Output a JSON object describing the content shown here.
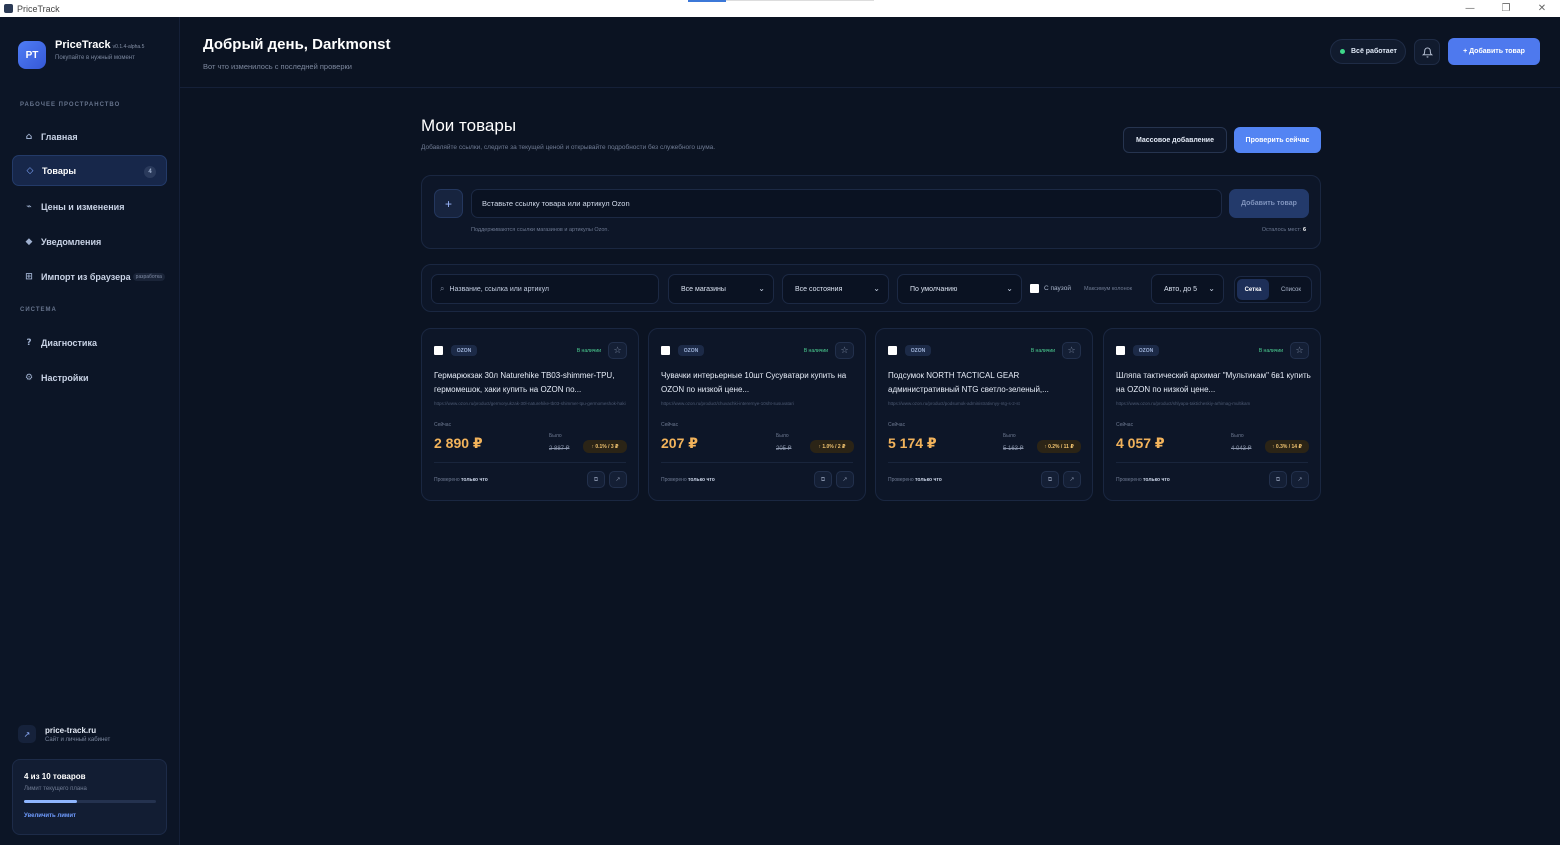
{
  "window": {
    "title": "PriceTrack",
    "controls": {
      "minimize": "—",
      "maximize": "❐",
      "close": "✕"
    }
  },
  "brand": {
    "logo": "PT",
    "name": "PriceTrack",
    "version": "v0.1.4-alpha.5",
    "tagline": "Покупайте в нужный момент"
  },
  "sidebar": {
    "workspace_label": "РАБОЧЕЕ ПРОСТРАНСТВО",
    "system_label": "СИСТЕМА",
    "items": [
      {
        "label": "Главная",
        "icon": "⌂"
      },
      {
        "label": "Товары",
        "icon": "◇",
        "badge": "4"
      },
      {
        "label": "Цены и изменения",
        "icon": "⌁"
      },
      {
        "label": "Уведомления",
        "icon": "◆"
      },
      {
        "label": "Импорт из браузера",
        "icon": "⊞",
        "tag": "разработка"
      }
    ],
    "system_items": [
      {
        "label": "Диагностика",
        "icon": "?"
      },
      {
        "label": "Настройки",
        "icon": "⚙"
      }
    ],
    "site": {
      "icon": "↗",
      "name": "price-track.ru",
      "sub": "Сайт и личный кабинет"
    },
    "plan": {
      "title": "4 из 10 товаров",
      "sub": "Лимит текущего плана",
      "progress": 0.4,
      "link": "Увеличить лимит"
    }
  },
  "header": {
    "greeting": "Добрый день, Darkmonst",
    "subtitle": "Вот что изменилось с последней проверки",
    "status": "Всё работает",
    "add_button": "+ Добавить товар"
  },
  "main": {
    "title": "Мои товары",
    "subtitle": "Добавляйте ссылки, следите за текущей ценой и открывайте подробности без служебного шума.",
    "bulk_button": "Массовое добавление",
    "check_button": "Проверить сейчас",
    "add": {
      "plus": "+",
      "placeholder": "Вставьте ссылку товара или артикул Ozon",
      "button": "Добавить товар",
      "hint": "Поддерживаются ссылки магазинов и артикулы Ozon.",
      "slots_label": "Осталось мест:",
      "slots_value": "6"
    },
    "filters": {
      "search_placeholder": "Название, ссылка или артикул",
      "store": "Все магазины",
      "state": "Все состояния",
      "sort": "По умолчанию",
      "pause_label": "С паузой",
      "columns_label": "Максимум колонок",
      "columns_value": "Авто, до 5",
      "view_grid": "Сетка",
      "view_list": "Список"
    },
    "card_labels": {
      "stock": "В наличии",
      "now": "Сейчас",
      "was": "Было",
      "checked_prefix": "Проверено",
      "checked_when": "только что"
    },
    "products": [
      {
        "store": "OZON",
        "title": "Гермарюкзак 30л Naturehike TB03-shimmer-TPU, гермомешок, хаки купить на OZON по...",
        "url": "https://www.ozon.ru/product/germoryukzak-30l-naturehike-tb03-shimmer-tpu-germomeshok-haki",
        "price": "2 890 ₽",
        "old_price": "2 887 ₽",
        "change": "↑ 0.1% / 3 ₽"
      },
      {
        "store": "OZON",
        "title": "Чувачки интерьерные 10шт Сусуватари купить на OZON по низкой цене...",
        "url": "https://www.ozon.ru/product/chuvachki-interernye-10sht-susuvatari",
        "price": "207 ₽",
        "old_price": "205 ₽",
        "change": "↑ 1.0% / 2 ₽"
      },
      {
        "store": "OZON",
        "title": "Подсумок NORTH TACTICAL GEAR административный NTG светло-зеленый,...",
        "url": "https://www.ozon.ru/product/podsumok-administrativnyy-ntg-s-2-st",
        "price": "5 174 ₽",
        "old_price": "5 163 ₽",
        "change": "↑ 0.2% / 11 ₽"
      },
      {
        "store": "OZON",
        "title": "Шляпа тактический архимаг \"Мультикам\" 6в1 купить на OZON по низкой цене...",
        "url": "https://www.ozon.ru/product/shlyapa-takticheskiy-arhimag-multikam",
        "price": "4 057 ₽",
        "old_price": "4 043 ₽",
        "change": "↑ 0.3% / 14 ₽"
      }
    ]
  },
  "colors": {
    "accent": "#4e79ee",
    "price": "#f2b35b",
    "stock": "#4cd394",
    "background": "#0b1322"
  }
}
